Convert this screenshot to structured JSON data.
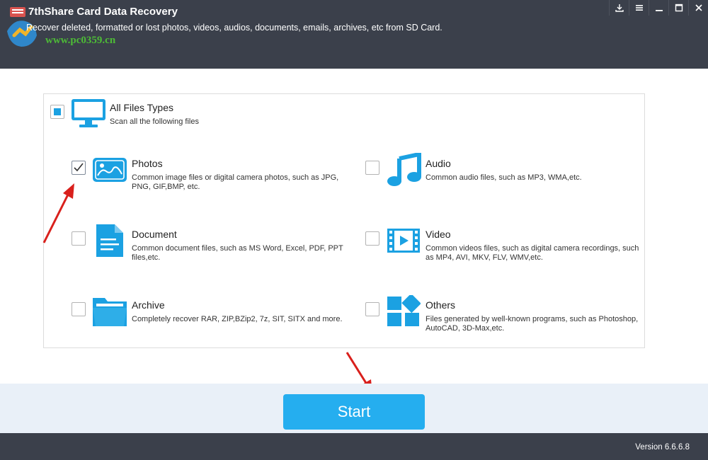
{
  "header": {
    "title": "7thShare Card Data Recovery",
    "subtitle": "Recover deleted, formatted or lost photos, videos, audios, documents, emails, archives, etc from SD Card.",
    "watermark": "www.pc0359.cn"
  },
  "window_controls": [
    "download-icon",
    "menu-icon",
    "minimize-icon",
    "maximize-icon",
    "close-icon"
  ],
  "all_types": {
    "title": "All Files Types",
    "description": "Scan all the following files",
    "state": "partial"
  },
  "file_types": [
    {
      "id": "photos",
      "title": "Photos",
      "description": "Common image files or digital camera photos, such as JPG, PNG, GIF,BMP, etc.",
      "checked": true,
      "icon": "photo-icon"
    },
    {
      "id": "audio",
      "title": "Audio",
      "description": "Common audio files, such as MP3, WMA,etc.",
      "checked": false,
      "icon": "music-note-icon"
    },
    {
      "id": "document",
      "title": "Document",
      "description": "Common document files, such as MS Word, Excel, PDF, PPT files,etc.",
      "checked": false,
      "icon": "document-icon"
    },
    {
      "id": "video",
      "title": "Video",
      "description": "Common videos files, such as digital camera recordings, such as MP4, AVI, MKV, FLV, WMV,etc.",
      "checked": false,
      "icon": "video-icon"
    },
    {
      "id": "archive",
      "title": "Archive",
      "description": "Completely recover RAR, ZIP,BZip2, 7z, SIT, SITX and more.",
      "checked": false,
      "icon": "folder-icon"
    },
    {
      "id": "others",
      "title": "Others",
      "description": "Files generated by well-known programs, such as Photoshop, AutoCAD, 3D-Max,etc.",
      "checked": false,
      "icon": "others-icon"
    }
  ],
  "start_button": {
    "label": "Start"
  },
  "footer": {
    "version": "Version 6.6.6.8"
  },
  "colors": {
    "accent": "#25aeef",
    "icon_blue": "#1ba1e2",
    "header_bg": "#3b404b",
    "arrow_red": "#d9201c"
  }
}
